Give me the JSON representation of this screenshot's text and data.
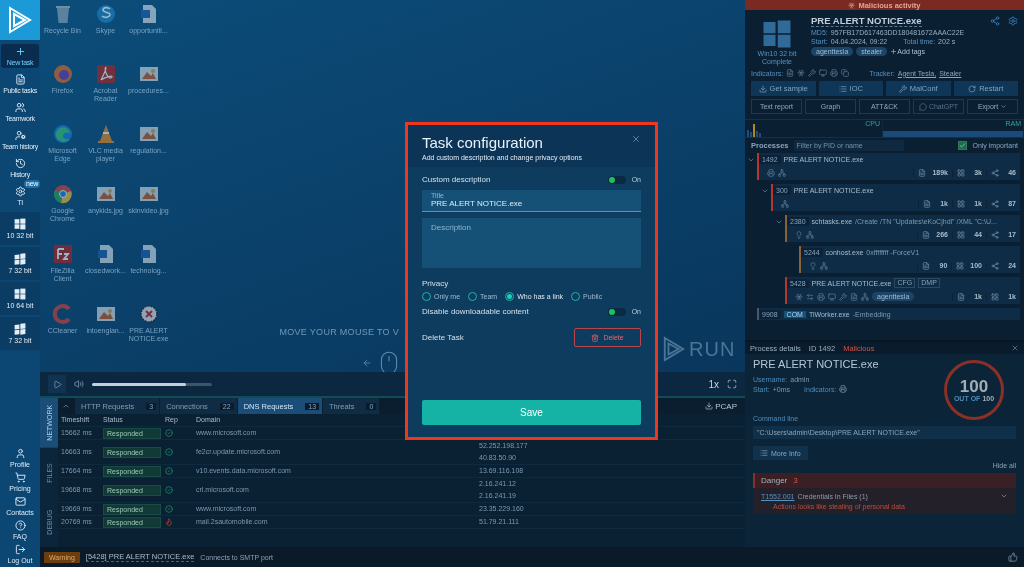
{
  "sidebar": {
    "nav": [
      {
        "label": "New task",
        "selected": true
      },
      {
        "label": "Public tasks",
        "selected": false
      },
      {
        "label": "Teamwork",
        "selected": false
      },
      {
        "label": "Team history",
        "selected": false
      },
      {
        "label": "History",
        "selected": false
      },
      {
        "label": "TI",
        "badge": "new",
        "selected": false
      }
    ],
    "os_shortcuts": [
      {
        "label": "10 32 bit",
        "kind": "win10"
      },
      {
        "label": "7 32 bit",
        "kind": "win7"
      },
      {
        "label": "10 64 bit",
        "kind": "win10"
      },
      {
        "label": "7 32 bit",
        "kind": "win7"
      }
    ],
    "account": [
      {
        "label": "Profile"
      },
      {
        "label": "Pricing"
      },
      {
        "label": "Contacts"
      },
      {
        "label": "FAQ"
      },
      {
        "label": "Log Out"
      }
    ]
  },
  "desktop": {
    "icons": [
      {
        "label": "Recycle Bin",
        "kind": "recycle"
      },
      {
        "label": "Firefox",
        "kind": "firefox"
      },
      {
        "label": "Microsoft Edge",
        "kind": "edge"
      },
      {
        "label": "Google Chrome",
        "kind": "chrome"
      },
      {
        "label": "FileZilla Client",
        "kind": "filezilla"
      },
      {
        "label": "CCleaner",
        "kind": "ccleaner"
      },
      {
        "label": "Skype",
        "kind": "skype"
      },
      {
        "label": "Acrobat Reader",
        "kind": "pdf"
      },
      {
        "label": "VLC media player",
        "kind": "vlc"
      },
      {
        "label": "anykids.jpg",
        "kind": "image"
      },
      {
        "label": "closedwork...",
        "kind": "word"
      },
      {
        "label": "intoenglan...",
        "kind": "image"
      },
      {
        "label": "opportuniti...",
        "kind": "word"
      },
      {
        "label": "procedures...",
        "kind": "image"
      },
      {
        "label": "regulation...",
        "kind": "image"
      },
      {
        "label": "skinvideo.jpg",
        "kind": "image"
      },
      {
        "label": "technolog...",
        "kind": "word"
      },
      {
        "label": "PRE ALERT NOTICE.exe",
        "kind": "exe"
      }
    ],
    "hint": "MOVE YOUR MOUSE TO V",
    "logo_text": "RUN"
  },
  "player": {
    "volume": {
      "level": 0.78
    },
    "speed": "1x"
  },
  "network_panel": {
    "side_tabs": [
      {
        "label": "NETWORK",
        "selected": true
      },
      {
        "label": "FILES",
        "selected": false
      },
      {
        "label": "DEBUG",
        "selected": false
      }
    ],
    "tabs": [
      {
        "label": "HTTP Requests",
        "count": "3",
        "selected": false
      },
      {
        "label": "Connections",
        "count": "22",
        "selected": false
      },
      {
        "label": "DNS Requests",
        "count": "13",
        "selected": true
      },
      {
        "label": "Threats",
        "count": "0",
        "selected": false
      }
    ],
    "export_button": "PCAP",
    "columns": [
      "Timeshift",
      "Status",
      "Rep",
      "Domain"
    ],
    "rows": [
      {
        "timeshift": "15662 ms",
        "status": "Responded",
        "kind": "safe",
        "domain": "www.microsoft.com"
      },
      {
        "timeshift": "16663 ms",
        "status": "Responded",
        "kind": "safe",
        "domain": "fe2cr.update.microsoft.com",
        "column_5": [
          "52.252.198.177",
          "40.83.50.90"
        ]
      },
      {
        "timeshift": "17664 ms",
        "status": "Responded",
        "kind": "safe",
        "domain": "v10.events.data.microsoft.com",
        "column_5": [
          "13.69.116.108"
        ]
      },
      {
        "timeshift": "19668 ms",
        "status": "Responded",
        "kind": "safe",
        "domain": "crl.microsoft.com",
        "column_5": [
          "2.16.241.12",
          "2.16.241.19"
        ]
      },
      {
        "timeshift": "19669 ms",
        "status": "Responded",
        "kind": "safe",
        "domain": "www.microsoft.com",
        "column_5": [
          "23.35.229.160"
        ]
      },
      {
        "timeshift": "20769 ms",
        "status": "Responded",
        "kind": "malicious",
        "domain": "mail.2sautomobile.com",
        "column_5": [
          "51.79.21.111"
        ]
      }
    ]
  },
  "status_bar": {
    "badge": "Warning",
    "process": "[5428] PRE ALERT NOTICE.exe",
    "message": "Connects to SMTP port"
  },
  "report": {
    "banner": "Malicious activity",
    "os": "Win10 32 bit",
    "status": "Complete",
    "title": "PRE ALERT NOTICE.exe",
    "md5_label": "MD5:",
    "md5": "957FB17D617463DD180481672AAAC22E",
    "start_label": "Start:",
    "start": "04.04.2024, 09:22",
    "total_label": "Total time:",
    "total": "202 s",
    "tags": [
      "agenttesla",
      "stealer"
    ],
    "add_tags": "Add tags",
    "indicators_label": "Indicators:",
    "tracker_label": "Tracker:",
    "trackers": [
      "Agent Tesla,",
      "Stealer"
    ],
    "actions": [
      "Get sample",
      "IOC",
      "MalConf",
      "Restart"
    ],
    "reports": [
      {
        "label": "Text report",
        "disabled": false
      },
      {
        "label": "Graph",
        "disabled": false
      },
      {
        "label": "ATT&CK",
        "disabled": false
      },
      {
        "label": "ChatGPT",
        "disabled": true
      },
      {
        "label": "Export",
        "disabled": false,
        "dropdown": true
      }
    ],
    "cpu_label": "CPU",
    "ram_label": "RAM"
  },
  "processes": {
    "title": "Processes",
    "filter_placeholder": "Filter by PID or name",
    "only_important": {
      "label": "Only important",
      "checked": true
    },
    "tree": [
      {
        "pid": "1492",
        "name": "PRE ALERT NOTICE.exe",
        "color": "#b8372b",
        "expanded": true,
        "stats": [
          "189k",
          "3k",
          "46"
        ],
        "children": [
          {
            "pid": "300",
            "name": "PRE ALERT NOTICE.exe",
            "color": "#b8372b",
            "expanded": true,
            "stats": [
              "1k",
              "1k",
              "87"
            ],
            "children": [
              {
                "pid": "2380",
                "name": "schtasks.exe",
                "args": "/Create /TN \"Updates\\eKoCjhdl\" /XML \"C:\\U...",
                "color": "#8a6238",
                "expanded": true,
                "stats": [
                  "266",
                  "44",
                  "17"
                ],
                "children": [
                  {
                    "pid": "5244",
                    "name": "conhost.exe",
                    "args": "0xffffffff -ForceV1",
                    "color": "#8a6238",
                    "stats": [
                      "90",
                      "100",
                      "24"
                    ]
                  }
                ]
              },
              {
                "pid": "5428",
                "name": "PRE ALERT NOTICE.exe",
                "badges": [
                  "CFG",
                  "DMP"
                ],
                "color": "#b8372b",
                "tags": [
                  "agenttesla"
                ],
                "stats": [
                  "1k",
                  "1k"
                ]
              }
            ]
          }
        ]
      },
      {
        "pid": "9908",
        "prefix": "COM",
        "name": "TiWorker.exe",
        "args": "-Embedding",
        "color": "#4a5866"
      }
    ]
  },
  "process_details": {
    "title": "Process details",
    "id": "ID 1492",
    "verdict": "Malicious",
    "name": "PRE ALERT NOTICE.exe",
    "username_label": "Username:",
    "username": "admin",
    "start_label": "Start:",
    "start": "+0ms",
    "indicators_label": "Indicators:",
    "score": "100",
    "score_caption": "OUT OF",
    "score_max": "100",
    "command_label": "Command line",
    "command": "\"C:\\Users\\admin\\Desktop\\PRE ALERT NOTICE.exe\"",
    "more_info": "More Info",
    "hide_all": "Hide all",
    "danger": {
      "label": "Danger",
      "count": "3",
      "items": [
        {
          "id": "T1552.001",
          "title": "Credentials In Files (1)",
          "detail": "Actions looks like stealing of personal data",
          "expanded": true
        }
      ]
    }
  },
  "dialog": {
    "title": "Task configuration",
    "subtitle": "Add custom description and change privacy options",
    "custom_description": {
      "label": "Custom description",
      "on": true,
      "state_label": "On"
    },
    "title_field": {
      "label": "Title",
      "value": "PRE ALERT NOTICE.exe"
    },
    "description_field": {
      "placeholder": "Description"
    },
    "privacy": {
      "label": "Privacy",
      "options": [
        {
          "label": "Only me",
          "selected": false
        },
        {
          "label": "Team",
          "selected": false
        },
        {
          "label": "Who has a link",
          "selected": true
        },
        {
          "label": "Public",
          "selected": false
        }
      ]
    },
    "disable_downloads": {
      "label": "Disable downloadable content",
      "on": true,
      "state_label": "On"
    },
    "delete": {
      "label": "Delete Task",
      "button": "Delete"
    },
    "save": "Save"
  }
}
